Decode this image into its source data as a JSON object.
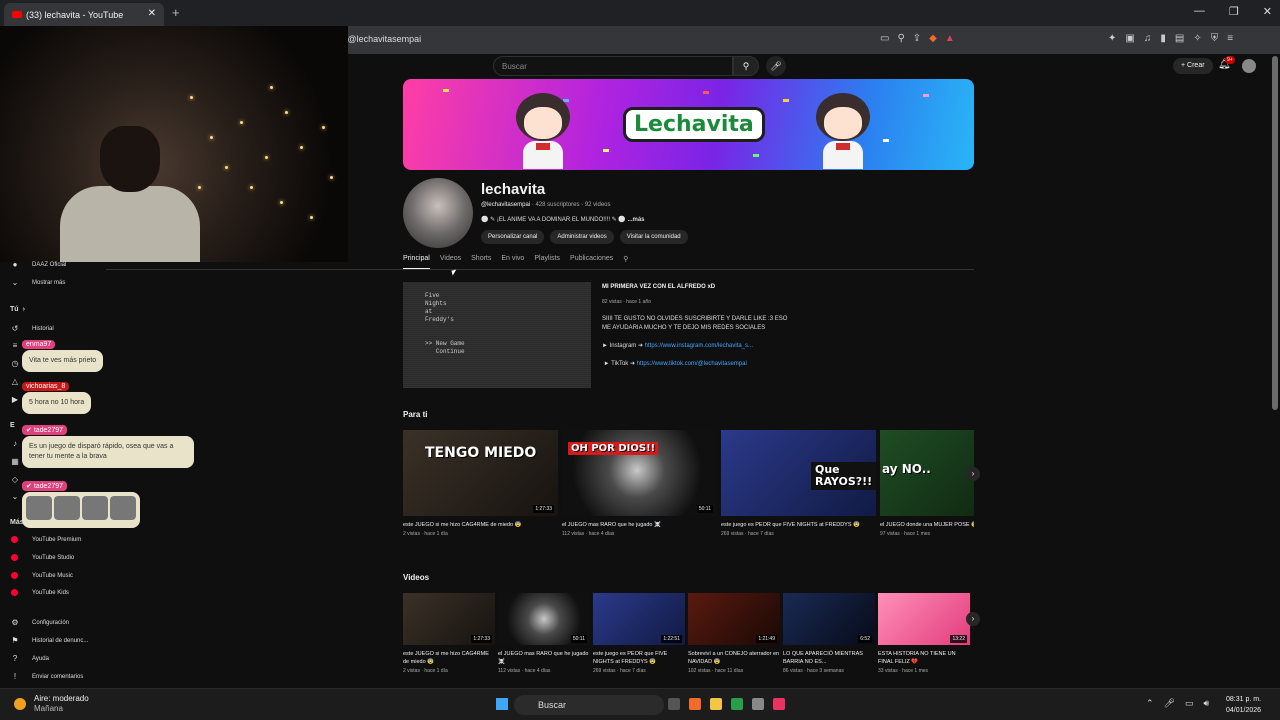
{
  "browser": {
    "tab_title": "(33) lechavita - YouTube",
    "url": "/@lechavitasempai"
  },
  "header": {
    "search_placeholder": "Buscar",
    "create_label": "Crear",
    "notif_badge": "9+"
  },
  "banner": {
    "logo_text": "Lechavita"
  },
  "channel": {
    "name": "lechavita",
    "handle": "@lechavitasempai",
    "stats": "· 428 suscriptores · 92 videos",
    "description": "¡EL ANIME VA A DOMINAR EL MUNDO!!!!",
    "more": "...más",
    "buttons": [
      "Personalizar canal",
      "Administrar videos",
      "Visitar la comunidad"
    ],
    "tabs": [
      "Principal",
      "Videos",
      "Shorts",
      "En vivo",
      "Playlists",
      "Publicaciones"
    ]
  },
  "featured": {
    "title": "MI PRIMERA VEZ CON EL ALFREDO xD",
    "meta": "82 vistas · hace 1 año",
    "desc1": "SIIII TE GUSTO NO OLVIDES SUSCRIBIRTE Y DARLE LIKE :3 ESO",
    "desc2": "ME AYUDARIA MUCHO Y TE DEJO MIS REDES SOCIALES",
    "ig_label": "► Instagram ➜",
    "ig_link": "https://www.instagram.com/lechavita_s...",
    "tt_label": "► TikTok ➜",
    "tt_link": "https://www.tiktok.com/@lechavitasempai",
    "thumb_text": "Five\nNights\nat\nFreddy's\n\n\n>> New Game\n   Continue"
  },
  "para_ti": {
    "title": "Para ti",
    "cards": [
      {
        "title": "este JUEGO si me hizo CAG4RME de miedo 😨",
        "meta": "2 vistas · hace 1 día",
        "duration": "1:27:33",
        "overlay": "TENGO MIEDO"
      },
      {
        "title": "el JUEGO mas RARO que he jugado ☠️",
        "meta": "112 vistas · hace 4 días",
        "duration": "50:11",
        "overlay": "OH POR DIOS!!"
      },
      {
        "title": "este juego es PEOR que FIVE NIGHTS at FREDDYS 😨",
        "meta": "269 vistas · hace 7 días",
        "duration": "",
        "overlay": "Que RAYOS?!!"
      },
      {
        "title": "el JUEGO donde una MUJER POSE 😨",
        "meta": "97 vistas · hace 1 mes",
        "duration": "",
        "overlay": "ay NO.."
      }
    ]
  },
  "videos": {
    "title": "Videos",
    "cards": [
      {
        "title": "este JUEGO si me hizo CAG4RME de miedo 😨",
        "meta": "2 vistas · hace 1 día",
        "duration": "1:27:33"
      },
      {
        "title": "el JUEGO mas RARO que he jugado ☠️",
        "meta": "112 vistas · hace 4 días",
        "duration": "50:11"
      },
      {
        "title": "este juego es PEOR que FIVE NIGHTS at FREDDYS 😨",
        "meta": "269 vistas · hace 7 días",
        "duration": "1:22:51"
      },
      {
        "title": "Sobreviví a un CONEJO aterrador en NAVIDAD 😨",
        "meta": "102 vistas · hace 11 días",
        "duration": "1:21:49"
      },
      {
        "title": "LO QUE APARECIÓ MIENTRAS BARRIA NO ES...",
        "meta": "86 vistas · hace 3 semanas",
        "duration": "6:52"
      },
      {
        "title": "ESTA HISTORIA NO TIENE UN FINAL FELIZ 💔",
        "meta": "33 vistas · hace 1 mes",
        "duration": "13:22"
      }
    ]
  },
  "sidebar": {
    "daaz": "DAAZ Oficial",
    "mostrar_mas": "Mostrar más",
    "tu": "Tú",
    "historial": "Historial",
    "mas": "Más",
    "premium": [
      "YouTube Premium",
      "YouTube Studio",
      "YouTube Music",
      "YouTube Kids"
    ],
    "config": [
      "Configuración",
      "Historial de denunc...",
      "Ayuda",
      "Enviar comentarios"
    ]
  },
  "chat": [
    {
      "user": "enma97",
      "msg": "Vita te ves más prieto"
    },
    {
      "user": "vichoarias_8",
      "msg": "5 hora no 10 hora"
    },
    {
      "user": "tade2797",
      "msg": "Es un juego de disparó rápido, osea que vas a tener tu mente a la brava"
    },
    {
      "user": "tade2797",
      "msg": ""
    }
  ],
  "taskbar": {
    "weather": "Aire: moderado",
    "weather_sub": "Mañana",
    "search": "Buscar",
    "time": "08:31 p. m.",
    "date": "04/01/2026"
  }
}
